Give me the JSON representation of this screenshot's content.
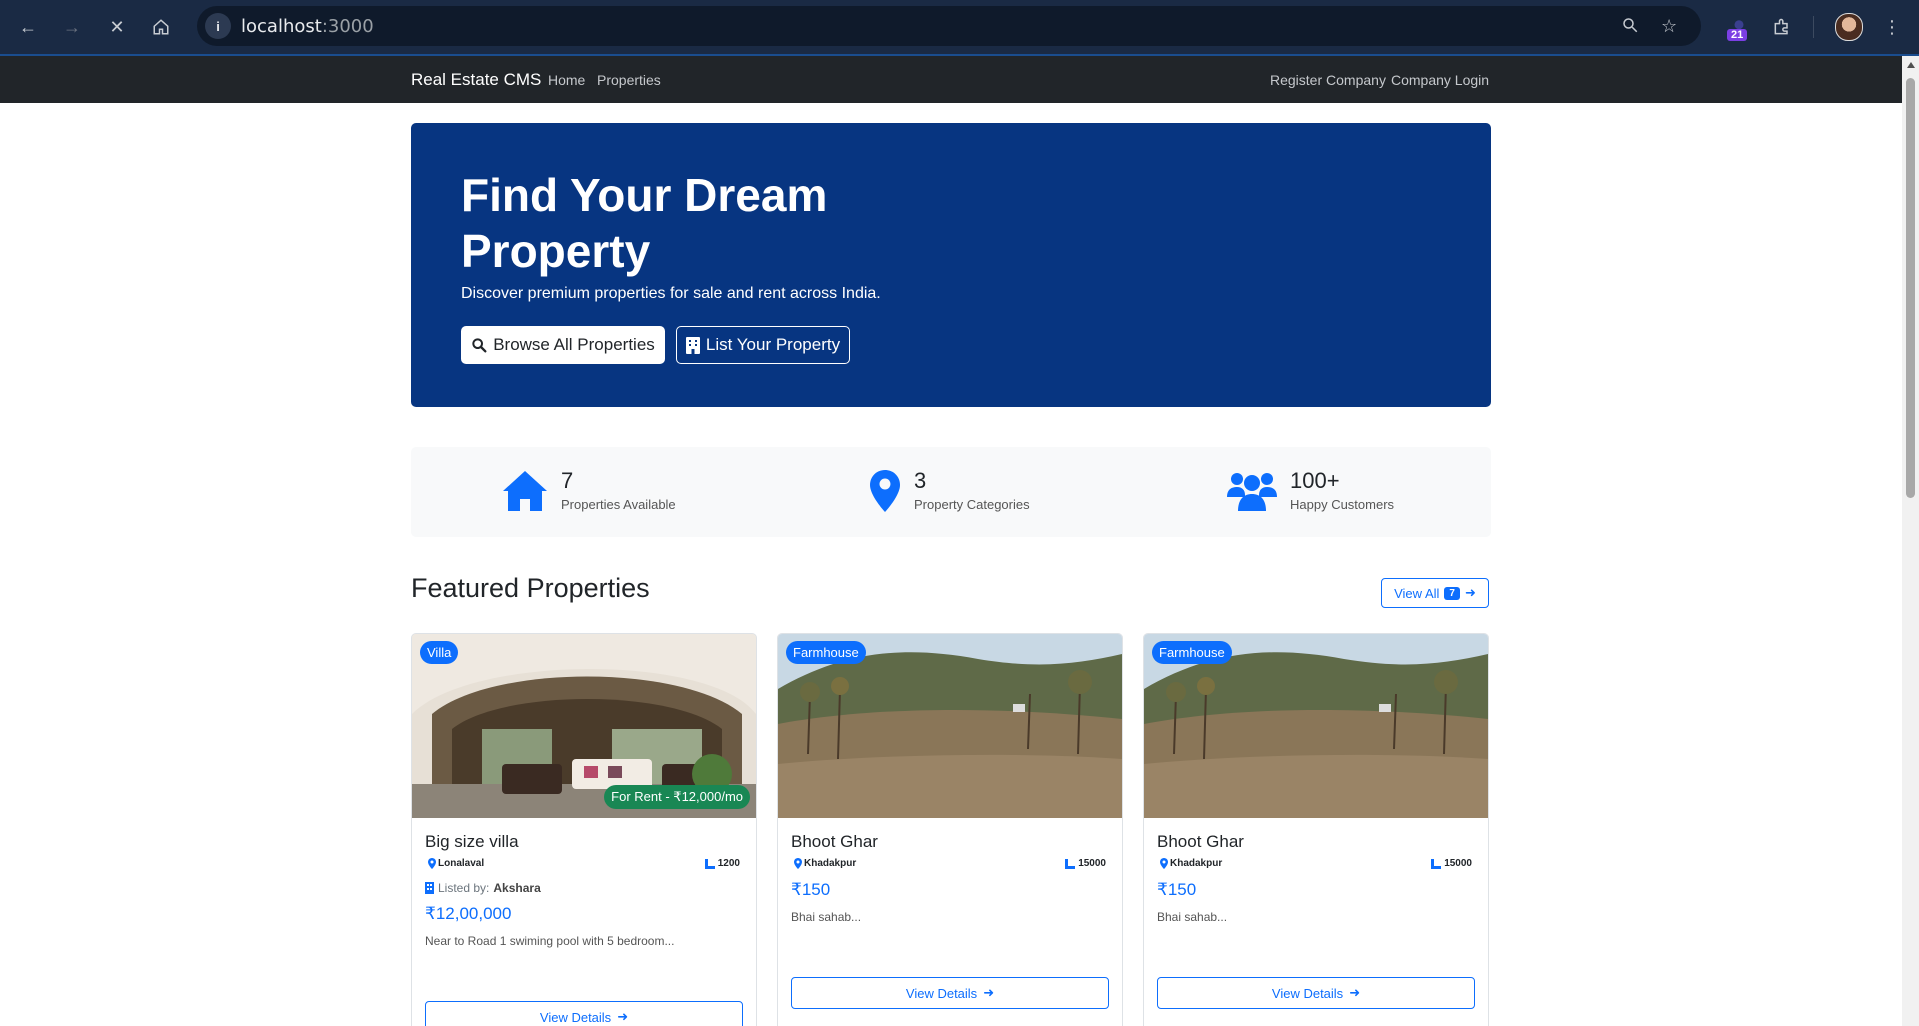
{
  "browser": {
    "url_host": "localhost",
    "url_port": ":3000",
    "extension_badge": "21"
  },
  "navbar": {
    "brand": "Real Estate CMS",
    "links": [
      "Home",
      "Properties"
    ],
    "right_links": [
      "Register Company",
      "Company Login"
    ]
  },
  "hero": {
    "title": "Find Your Dream Property",
    "subtitle": "Discover premium properties for sale and rent across India.",
    "browse_label": "Browse All Properties",
    "list_label": "List Your Property",
    "background": "#073581"
  },
  "stats": [
    {
      "icon": "home-icon",
      "value": "7",
      "label": "Properties Available"
    },
    {
      "icon": "map-pin-icon",
      "value": "3",
      "label": "Property Categories"
    },
    {
      "icon": "users-icon",
      "value": "100+",
      "label": "Happy Customers"
    }
  ],
  "featured": {
    "title": "Featured Properties",
    "view_all_label": "View All",
    "count": "7"
  },
  "cards": [
    {
      "type": "Villa",
      "rent": "For Rent - ₹12,000/mo",
      "title": "Big size villa",
      "location": "Lonalaval",
      "area": "1200",
      "listed_by_label": "Listed by:",
      "listed_by": "Akshara",
      "price": "₹12,00,000",
      "desc": "Near to Road 1 swiming pool with 5 bedroom...",
      "button": "View Details"
    },
    {
      "type": "Farmhouse",
      "title": "Bhoot Ghar",
      "location": "Khadakpur",
      "area": "15000",
      "price": "₹150",
      "desc": "Bhai sahab...",
      "button": "View Details"
    },
    {
      "type": "Farmhouse",
      "title": "Bhoot Ghar",
      "location": "Khadakpur",
      "area": "15000",
      "price": "₹150",
      "desc": "Bhai sahab...",
      "button": "View Details"
    }
  ],
  "colors": {
    "primary": "#0d6efd",
    "success": "#198754",
    "navbar": "#212529"
  }
}
